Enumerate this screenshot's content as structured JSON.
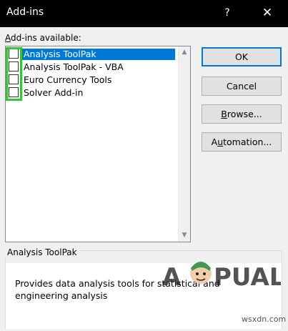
{
  "window": {
    "title": "Add-ins",
    "help_label": "?",
    "close_label": "✕"
  },
  "list": {
    "label": "Add-ins available:",
    "items": [
      {
        "label": "Analysis ToolPak",
        "checked": false,
        "selected": true
      },
      {
        "label": "Analysis ToolPak - VBA",
        "checked": false,
        "selected": false
      },
      {
        "label": "Euro Currency Tools",
        "checked": false,
        "selected": false
      },
      {
        "label": "Solver Add-in",
        "checked": false,
        "selected": false
      }
    ],
    "highlight_color": "#34c534",
    "selection_color": "#0078d7"
  },
  "buttons": {
    "ok": "OK",
    "cancel": "Cancel",
    "browse": "Browse...",
    "automation": "Automation..."
  },
  "description": {
    "title": "Analysis ToolPak",
    "text": "Provides data analysis tools for statistical and engineering analysis"
  },
  "watermark": {
    "logo_text": "APPUALS",
    "url": "wsxdn.com"
  }
}
